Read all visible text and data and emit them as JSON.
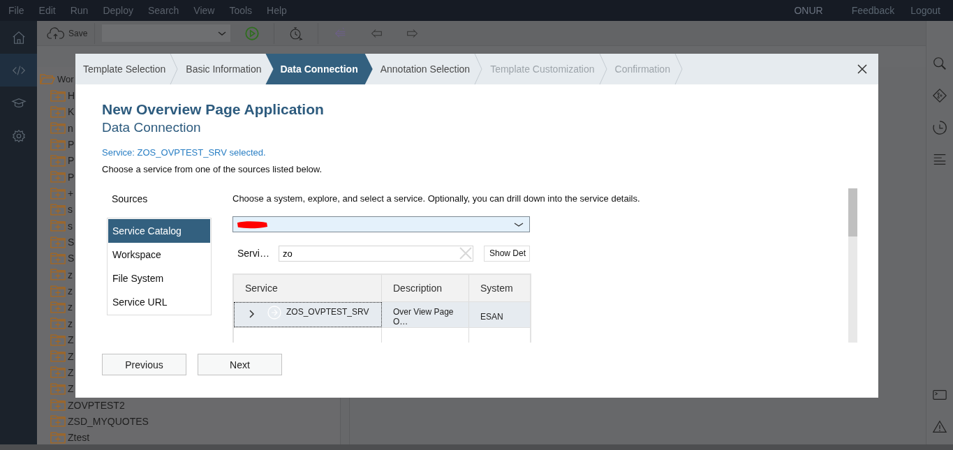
{
  "menu_bar": {
    "items": [
      "File",
      "Edit",
      "Run",
      "Deploy",
      "Search",
      "View",
      "Tools",
      "Help"
    ],
    "user": "ONUR",
    "links": [
      "Feedback",
      "Logout"
    ]
  },
  "left_rail": [
    {
      "kind": "home",
      "selected": false
    },
    {
      "kind": "code",
      "selected": true
    },
    {
      "kind": "learn",
      "selected": false
    },
    {
      "kind": "settings",
      "selected": false
    }
  ],
  "toolbar": {
    "save": "Save"
  },
  "file_tree": {
    "root": "Wor",
    "items": [
      "H",
      "K",
      "n",
      "P",
      "P",
      "P",
      "+",
      "s",
      "s",
      "S",
      "S",
      "z",
      "z",
      "z",
      "z",
      "Z",
      "Z",
      "Z",
      "Z",
      "ZOVPTEST2",
      "ZSD_MYQUOTES",
      "Ztest"
    ]
  },
  "right_rail": [
    {
      "kind": "search"
    },
    {
      "kind": "git"
    },
    {
      "kind": "history"
    },
    {
      "kind": "outline"
    },
    {
      "kind": "terminal"
    },
    {
      "kind": "warning"
    }
  ],
  "dialog": {
    "steps": [
      {
        "label": "Template Selection",
        "selected": false,
        "disabled": false
      },
      {
        "label": "Basic Information",
        "selected": false,
        "disabled": false
      },
      {
        "label": "Data Connection",
        "selected": true,
        "disabled": false
      },
      {
        "label": "Annotation Selection",
        "selected": false,
        "disabled": false
      },
      {
        "label": "Template Customization",
        "selected": false,
        "disabled": true
      },
      {
        "label": "Confirmation",
        "selected": false,
        "disabled": true
      }
    ],
    "title": "New Overview Page Application",
    "subtitle": "Data Connection",
    "status": "Service: ZOS_OVPTEST_SRV selected.",
    "instruction": "Choose a service from one of the sources listed below.",
    "sources_label": "Sources",
    "sources": [
      {
        "label": "Service Catalog",
        "selected": true
      },
      {
        "label": "Workspace",
        "selected": false
      },
      {
        "label": "File System",
        "selected": false
      },
      {
        "label": "Service URL",
        "selected": false
      }
    ],
    "hint": "Choose a system, explore, and select a service. Optionally, you can drill down into the service details.",
    "search": {
      "label": "Servi…",
      "value": "zo"
    },
    "show_details": "Show Det",
    "table": {
      "columns": [
        "Service",
        "Description",
        "System"
      ],
      "rows": [
        {
          "cells": [
            "ZOS_OVPTEST_SRV",
            "Over View Page O…",
            "ESAN"
          ],
          "selected": true,
          "expanded": false
        }
      ]
    },
    "buttons": [
      "Previous",
      "Next"
    ]
  }
}
